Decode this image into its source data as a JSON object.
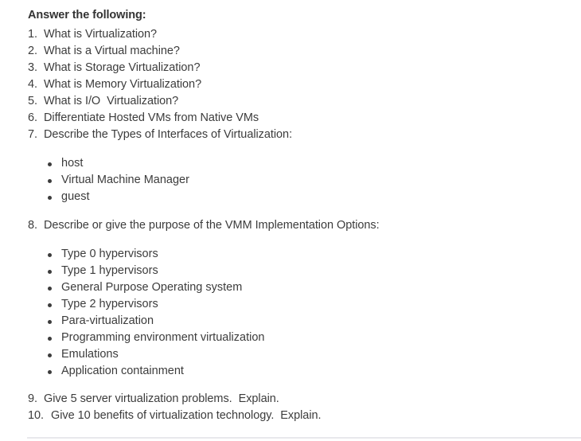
{
  "heading": "Answer the following:",
  "questions_top": [
    {
      "num": "1.",
      "text": "What is Virtualization?"
    },
    {
      "num": "2.",
      "text": "What is a Virtual machine?"
    },
    {
      "num": "3.",
      "text": "What is Storage Virtualization?"
    },
    {
      "num": "4.",
      "text": "What is Memory Virtualization?"
    },
    {
      "num": "5.",
      "text": "What is I/O  Virtualization?"
    },
    {
      "num": "6.",
      "text": "Differentiate Hosted VMs from Native VMs"
    },
    {
      "num": "7.",
      "text": "Describe the Types of Interfaces of Virtualization:"
    }
  ],
  "interfaces": [
    "host",
    "Virtual Machine Manager",
    "guest"
  ],
  "question8": {
    "num": "8.",
    "text": "Describe or give the purpose of the VMM Implementation Options:"
  },
  "vmm_options": [
    "Type 0 hypervisors",
    "Type 1 hypervisors",
    "General Purpose Operating system",
    "Type 2 hypervisors",
    "Para-virtualization",
    "Programming environment virtualization",
    "Emulations",
    "Application containment"
  ],
  "questions_bottom": [
    {
      "num": "9.",
      "text": "Give 5 server virtualization problems.  Explain."
    },
    {
      "num": "10.",
      "text": "Give 10 benefits of virtualization technology.  Explain."
    }
  ]
}
